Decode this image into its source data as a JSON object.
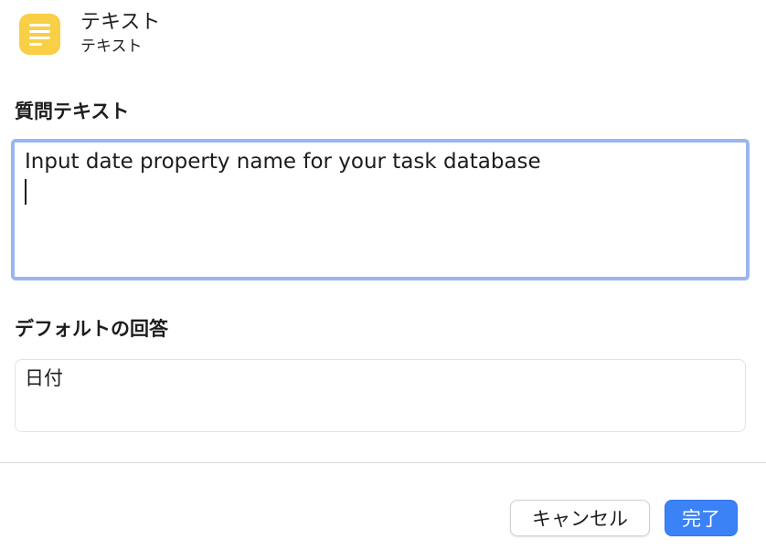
{
  "header": {
    "title": "テキスト",
    "subtitle": "テキスト",
    "icon": "text-lines-icon",
    "icon_color": "#f8cf45"
  },
  "question": {
    "label": "質問テキスト",
    "value": "Input date property name for your task database",
    "focus_color": "#9ab5f0"
  },
  "default_answer": {
    "label": "デフォルトの回答",
    "value": "日付"
  },
  "buttons": {
    "cancel_label": "キャンセル",
    "done_label": "完了",
    "done_color": "#3b82f7"
  }
}
